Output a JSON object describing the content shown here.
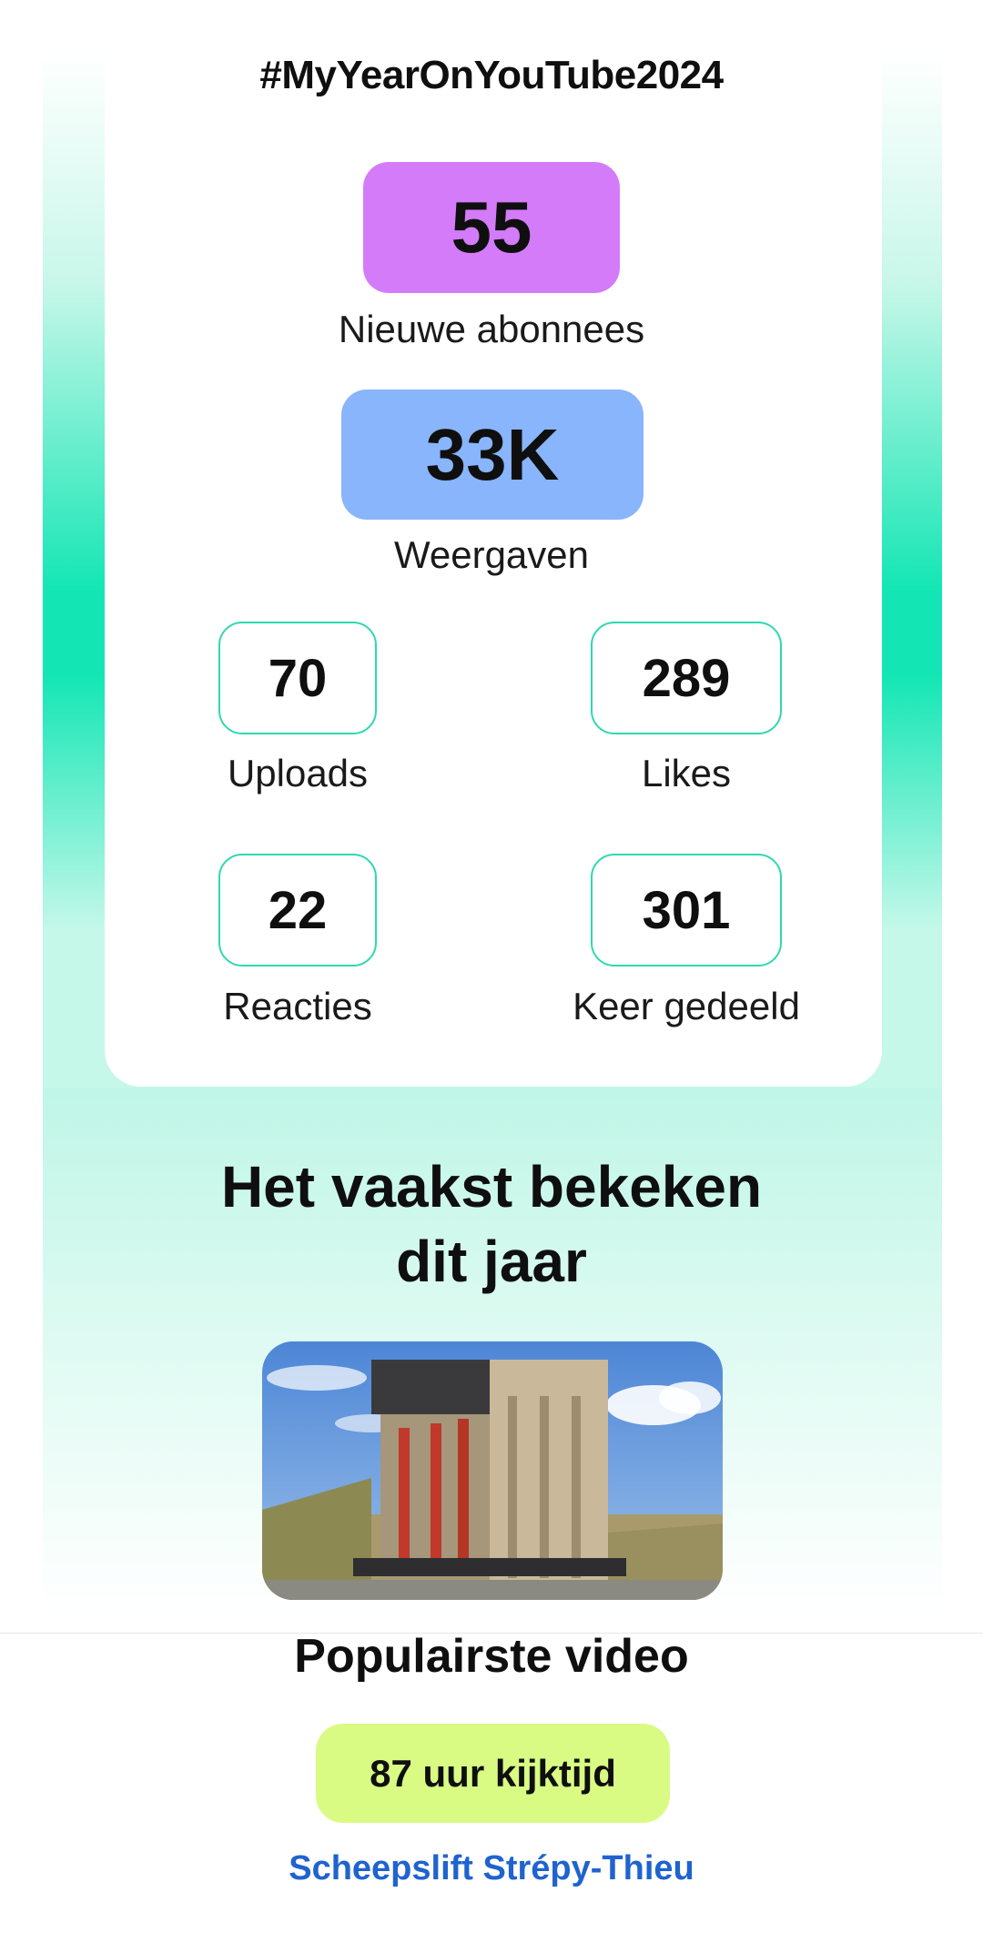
{
  "recap": {
    "hashtag": "#MyYearOnYouTube2024",
    "subscribers": {
      "value": "55",
      "label": "Nieuwe abonnees",
      "color": "#d47bfa"
    },
    "views": {
      "value": "33K",
      "label": "Weergaven",
      "color": "#88b5fb"
    },
    "stats": [
      {
        "value": "70",
        "label": "Uploads"
      },
      {
        "value": "289",
        "label": "Likes"
      },
      {
        "value": "22",
        "label": "Reacties"
      },
      {
        "value": "301",
        "label": "Keer gedeeld"
      }
    ]
  },
  "most_viewed": {
    "title_line1": "Het vaakst bekeken",
    "title_line2": "dit jaar",
    "thumbnail_icon": "boat-lift-thumbnail",
    "popular_label": "Populairste video",
    "watch_time": "87 uur kijktijd",
    "watch_time_color": "#d9fb84",
    "video_title": "Scheepslift Strépy-Thieu",
    "link_color": "#1f63cf"
  },
  "colors": {
    "accent_green": "#13e6b4",
    "stat_border": "#2fd8b0"
  }
}
